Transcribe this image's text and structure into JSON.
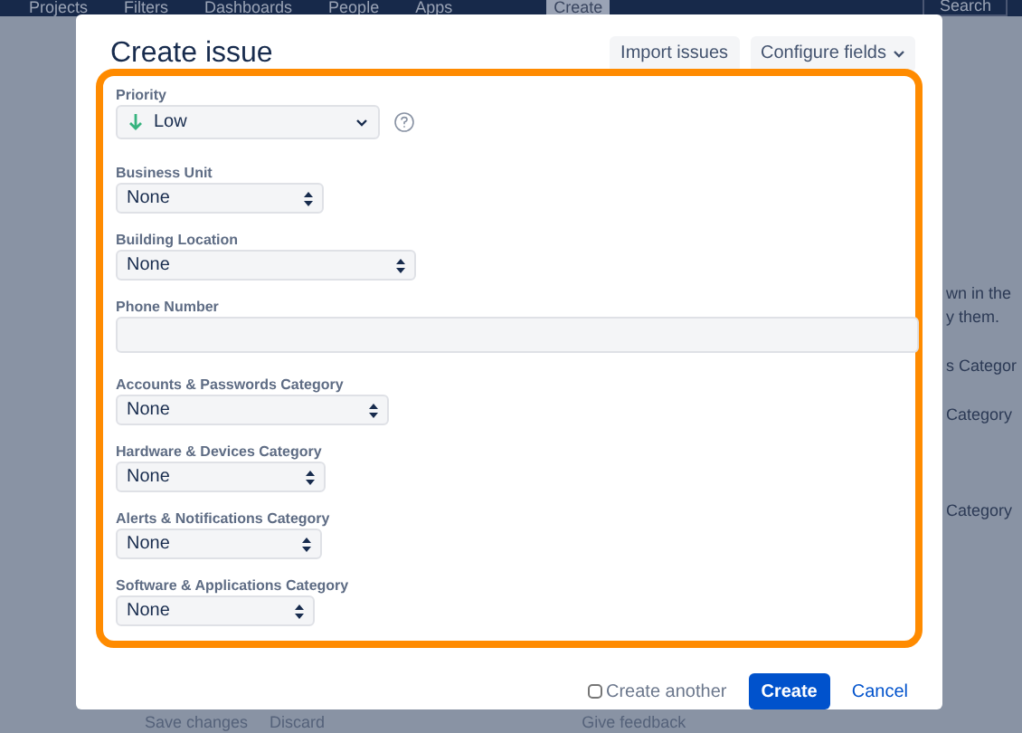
{
  "backdrop": {
    "nav_items": [
      {
        "label": "Projects"
      },
      {
        "label": "Filters"
      },
      {
        "label": "Dashboards"
      },
      {
        "label": "People"
      },
      {
        "label": "Apps"
      }
    ],
    "create_button": "Create",
    "search": {
      "placeholder": "Search"
    },
    "side_texts": [
      "wn in the",
      "y them.",
      "s Categor",
      "Category",
      "Category"
    ],
    "footer_buttons": [
      "Save changes",
      "Discard"
    ],
    "feedback": "Give feedback"
  },
  "dialog": {
    "title": "Create issue",
    "header_buttons": [
      {
        "label": "Import issues",
        "dropdown": false
      },
      {
        "label": "Configure fields",
        "dropdown": true
      }
    ],
    "fields": [
      {
        "kind": "priority",
        "label": "Priority",
        "value": "Low",
        "help": true
      },
      {
        "kind": "select",
        "label": "Business Unit",
        "value": "None"
      },
      {
        "kind": "select",
        "label": "Building Location",
        "value": "None"
      },
      {
        "kind": "text",
        "label": "Phone Number"
      },
      {
        "kind": "select",
        "label": "Accounts & Passwords Category",
        "value": "None"
      },
      {
        "kind": "select",
        "label": "Hardware & Devices Category",
        "value": "None"
      },
      {
        "kind": "select",
        "label": "Alerts & Notifications Category",
        "value": "None"
      },
      {
        "kind": "select",
        "label": "Software & Applications Category",
        "value": "None"
      }
    ],
    "create_another": {
      "label": "Create another",
      "checked": false
    },
    "submit": "Create",
    "cancel": "Cancel"
  }
}
